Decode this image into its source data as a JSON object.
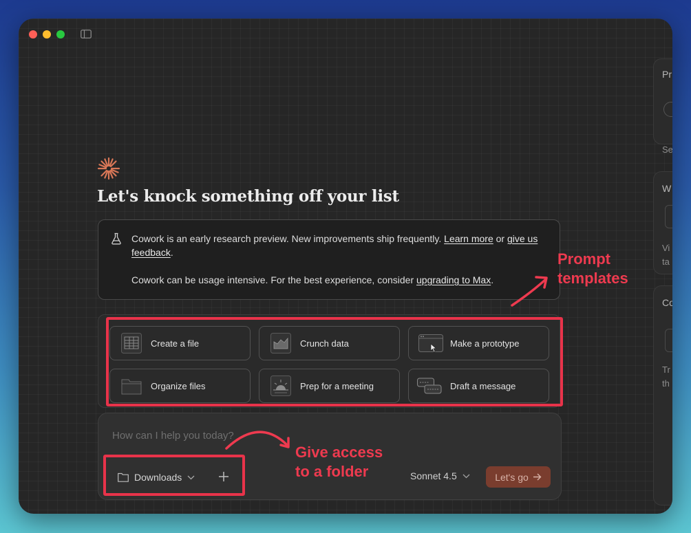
{
  "window": {
    "accent_color": "#d97757"
  },
  "headline": "Let's knock something off your list",
  "notice": {
    "line1_text": "Cowork is an early research preview. New improvements ship frequently.",
    "line1_link": "Learn more",
    "line1_or": "or",
    "line1_link2": "give us feedback",
    "line1_end": ".",
    "line2_text": "Cowork can be usage intensive. For the best experience, consider",
    "line2_link": "upgrading to Max",
    "line2_end": "."
  },
  "templates": [
    {
      "label": "Create a file",
      "icon": "spreadsheet-icon"
    },
    {
      "label": "Crunch data",
      "icon": "chart-icon"
    },
    {
      "label": "Make a prototype",
      "icon": "browser-window-icon"
    },
    {
      "label": "Organize files",
      "icon": "folder-icon"
    },
    {
      "label": "Prep for a meeting",
      "icon": "sunrise-icon"
    },
    {
      "label": "Draft a message",
      "icon": "chat-bubbles-icon"
    }
  ],
  "composer": {
    "placeholder": "How can I help you today?",
    "folder_label": "Downloads",
    "model_label": "Sonnet 4.5",
    "go_label": "Let's go"
  },
  "annotations": {
    "prompt_templates_line1": "Prompt",
    "prompt_templates_line2": "templates",
    "folder_line1": "Give access",
    "folder_line2": "to a folder"
  },
  "right_panel": {
    "p1_title": "Pr",
    "p1_sub": "Se",
    "p2_title": "W",
    "p2_line1": "Vi",
    "p2_line2": "ta",
    "p3_title": "Co",
    "p3_line1": "Tr",
    "p3_line2": "th"
  }
}
